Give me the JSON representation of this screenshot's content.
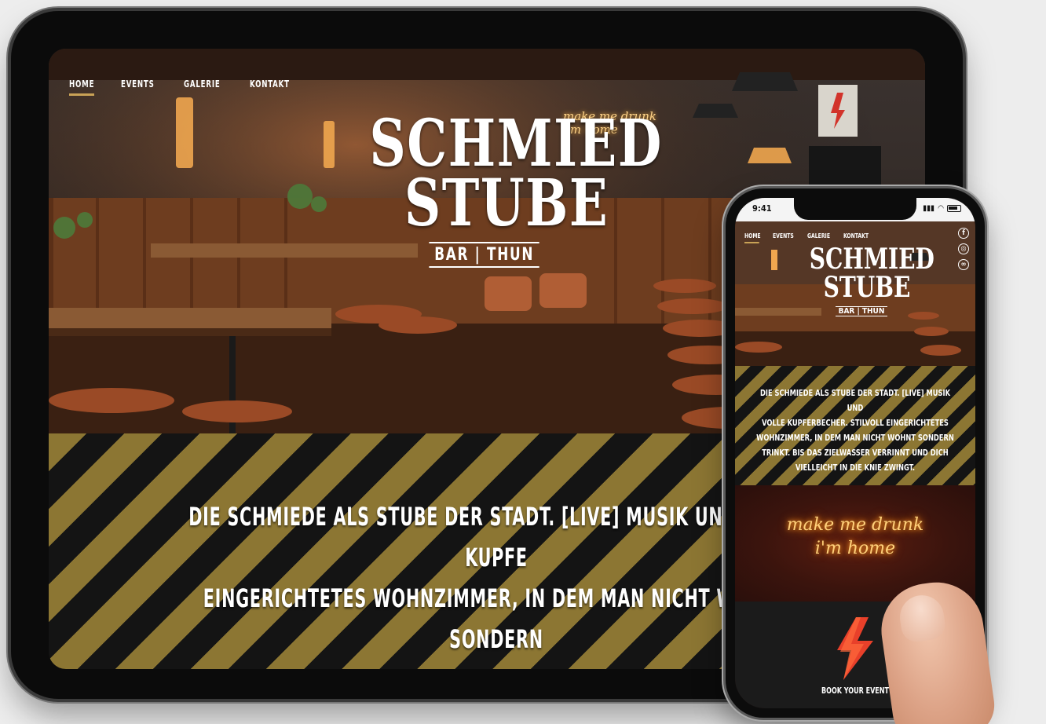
{
  "tablet": {
    "nav": [
      "HOME",
      "EVENTS",
      "GALERIE",
      "KONTAKT"
    ],
    "active_nav": "HOME",
    "logo": {
      "line1": "SCHMIED",
      "line2": "STUBE",
      "sub": "BAR | THUN"
    },
    "neon_sign": "make me drunk\ni'm home",
    "tagline": "DIE SCHMIEDE ALS STUBE DER STADT. [LIVE] MUSIK UND VOLLE KUPFE\nEINGERICHTETES WOHNZIMMER, IN DEM MAN NICHT WOHNT SONDERN\nZIELWASSER VERRINNT UND DICH VIELLEICHT IN DIE KNIE Z"
  },
  "phone": {
    "status": {
      "time": "9:41"
    },
    "nav": [
      "HOME",
      "EVENTS",
      "GALERIE",
      "KONTAKT"
    ],
    "logo": {
      "line1": "SCHMIED",
      "line2": "STUBE",
      "sub": "BAR | THUN"
    },
    "tagline": "DIE SCHMIEDE ALS STUBE DER STADT. [LIVE] MUSIK UND\nVOLLE KUPFERBECHER. STILVOLL EINGERICHTETES\nWOHNZIMMER, IN DEM MAN NICHT WOHNT SONDERN\nTRINKT. BIS DAS ZIELWASSER VERRINNT UND DICH\nVIELLEICHT IN DIE KNIE ZWINGT.",
    "neon": "make me drunk\ni'm home",
    "event_label": "BOOK YOUR EVENT"
  },
  "colors": {
    "gold": "#8c7633",
    "dark": "#141414",
    "accent": "#c9a256",
    "neon": "#ffd07a",
    "bolt": "#e8402a"
  },
  "icons": [
    "facebook-icon",
    "instagram-icon",
    "tripadvisor-icon",
    "lightning-bolt-icon"
  ]
}
